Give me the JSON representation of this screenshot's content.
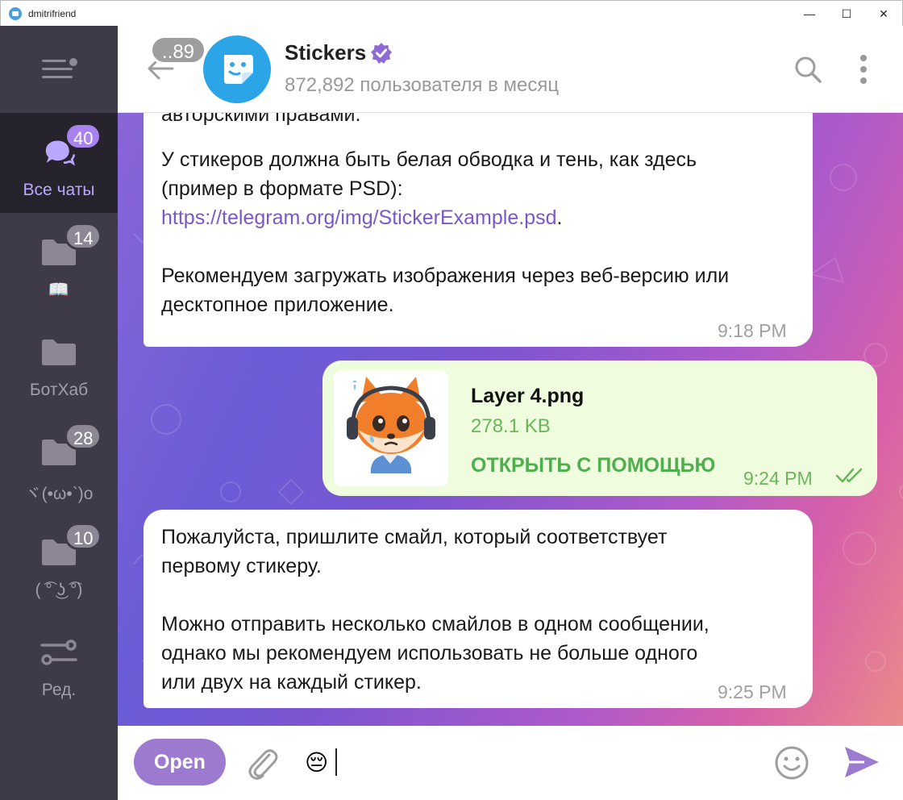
{
  "window": {
    "title": "dmitrifriend",
    "minimize": "—",
    "maximize": "☐",
    "close": "✕"
  },
  "sidebar": {
    "folders": [
      {
        "label": "Все чаты",
        "badge": "40",
        "active": true
      },
      {
        "label": "📖",
        "badge": "14",
        "active": false
      },
      {
        "label": "БотХаб",
        "badge": "",
        "active": false
      },
      {
        "label": "ヾ(•ω•`)o",
        "badge": "28",
        "active": false
      },
      {
        "label": "( ͡° ͜ʖ ͡°)",
        "badge": "10",
        "active": false
      }
    ],
    "edit_label": "Ред."
  },
  "header": {
    "unread_count": "..89",
    "name": "Stickers",
    "subtitle": "872,892 пользователя в месяц",
    "avatar_icon": "sticker-smile-icon",
    "verified_color": "#8d6ad6"
  },
  "messages": [
    {
      "direction": "in",
      "lines": [
        "авторскими правами.",
        "У стикеров должна быть белая обводка и тень, как здесь",
        "(пример в формате PSD):",
        "https://telegram.org/img/StickerExample.psd",
        ".",
        "Рекомендуем загружать изображения через веб-версию или",
        "десктопное приложение."
      ],
      "time": "9:18 PM"
    },
    {
      "direction": "out",
      "file_name": "Layer 4.png",
      "file_size": "278.1 KB",
      "open_with": "ОТКРЫТЬ С ПОМОЩЬЮ",
      "time": "9:24 PM",
      "status": "read"
    },
    {
      "direction": "in",
      "lines": [
        "Пожалуйста, пришлите смайл, который соответствует",
        "первому стикеру.",
        "Можно отправить несколько смайлов в одном сообщении,",
        "однако мы рекомендуем использовать не больше одного",
        "или двух на каждый стикер."
      ],
      "time": "9:25 PM"
    }
  ],
  "composer": {
    "open_button": "Open",
    "input_value": "😔",
    "accent": "#9b7ad0"
  }
}
